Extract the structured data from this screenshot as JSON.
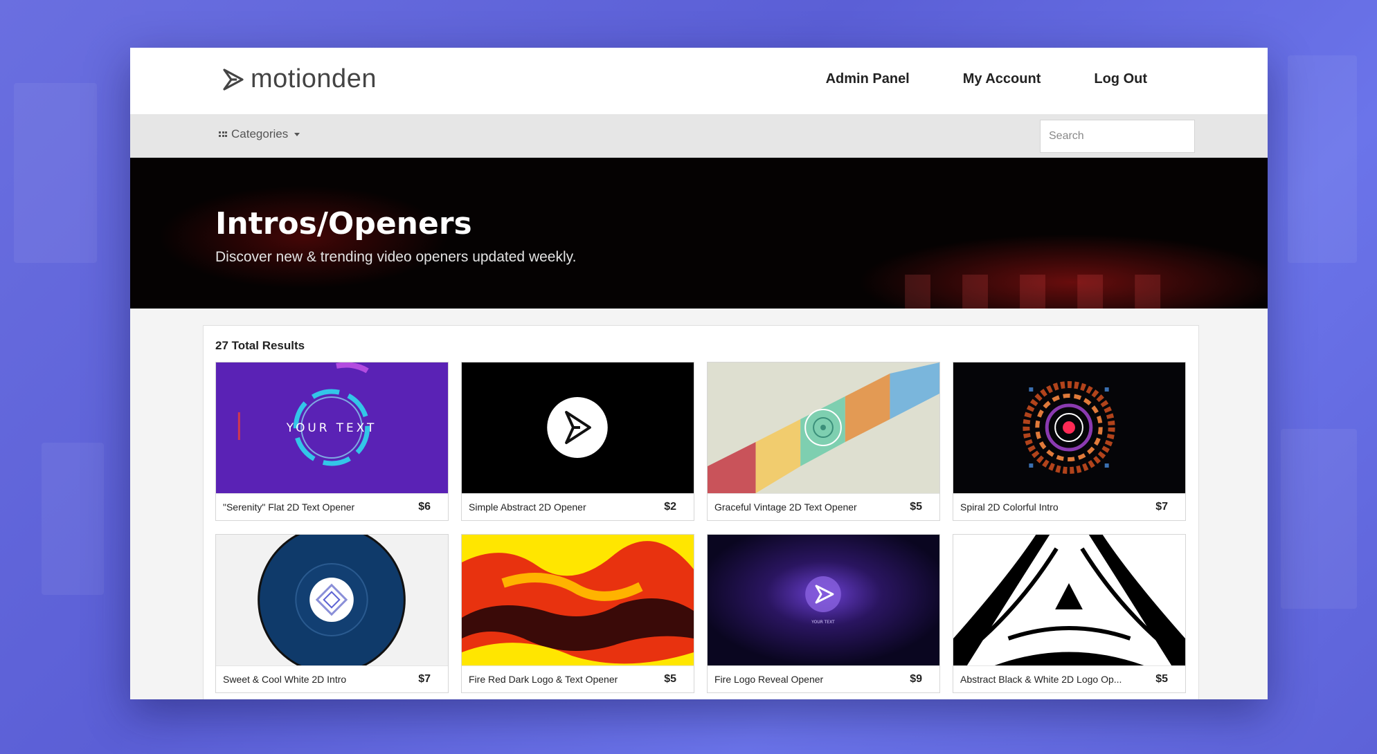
{
  "brand": {
    "name": "motionden"
  },
  "nav": {
    "admin_panel": "Admin Panel",
    "my_account": "My Account",
    "log_out": "Log Out"
  },
  "subbar": {
    "categories_label": "Categories",
    "search_placeholder": "Search"
  },
  "hero": {
    "title": "Intros/Openers",
    "subtitle": "Discover new & trending video openers updated weekly."
  },
  "results": {
    "label": "27 Total Results",
    "items": [
      {
        "title": "\"Serenity\" Flat 2D Text Opener",
        "price": "$6",
        "thumb_text": "YOUR TEXT"
      },
      {
        "title": "Simple Abstract 2D Opener",
        "price": "$2"
      },
      {
        "title": "Graceful Vintage 2D Text Opener",
        "price": "$5"
      },
      {
        "title": "Spiral 2D Colorful Intro",
        "price": "$7"
      },
      {
        "title": "Sweet & Cool White 2D Intro",
        "price": "$7"
      },
      {
        "title": "Fire Red Dark Logo & Text Opener",
        "price": "$5"
      },
      {
        "title": "Fire Logo Reveal Opener",
        "price": "$9",
        "thumb_text": "YOUR TEXT"
      },
      {
        "title": "Abstract Black & White 2D Logo Op...",
        "price": "$5"
      }
    ]
  },
  "colors": {
    "page_background": "#6366dc",
    "hero_background": "#050202",
    "card_border": "#d6d6d6"
  },
  "icons": [
    "motionden-logo-icon",
    "grid-icon",
    "caret-down-icon",
    "search-icon"
  ]
}
